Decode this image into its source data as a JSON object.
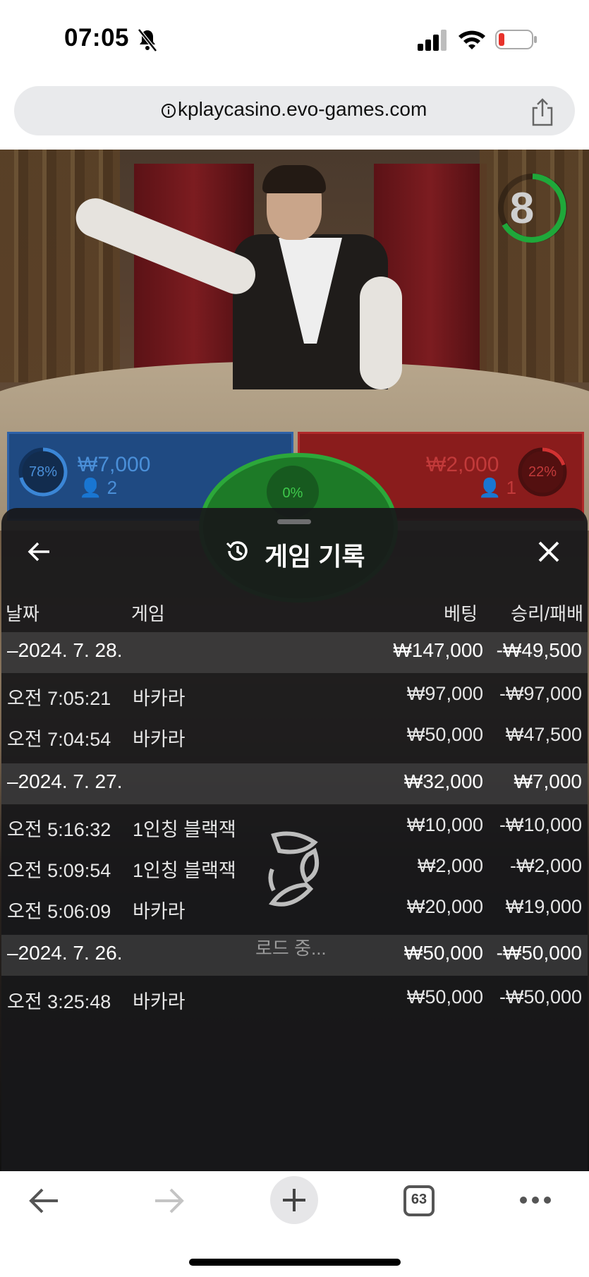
{
  "status": {
    "time": "07:05"
  },
  "browser": {
    "url": "kplaycasino.evo-games.com",
    "tab_count": "63"
  },
  "game": {
    "timer": "8",
    "player": {
      "percent": "78%",
      "amount": "₩7,000",
      "count": "2"
    },
    "banker": {
      "percent": "22%",
      "amount": "₩2,000",
      "count": "1"
    },
    "tie": {
      "percent": "0%"
    }
  },
  "history": {
    "title": "게임 기록",
    "headers": {
      "date": "날짜",
      "game": "게임",
      "bet": "베팅",
      "result": "승리/패배"
    },
    "loading": "로드 중...",
    "groups": [
      {
        "date": "–2024. 7. 28.",
        "bet": "₩147,000",
        "result": "-₩49,500",
        "rows": [
          {
            "time": "오전 7:05:21",
            "game": "바카라",
            "bet": "₩97,000",
            "result": "-₩97,000"
          },
          {
            "time": "오전 7:04:54",
            "game": "바카라",
            "bet": "₩50,000",
            "result": "₩47,500"
          }
        ]
      },
      {
        "date": "–2024. 7. 27.",
        "bet": "₩32,000",
        "result": "₩7,000",
        "rows": [
          {
            "time": "오전 5:16:32",
            "game": "1인칭 블랙잭",
            "bet": "₩10,000",
            "result": "-₩10,000"
          },
          {
            "time": "오전 5:09:54",
            "game": "1인칭 블랙잭",
            "bet": "₩2,000",
            "result": "-₩2,000"
          },
          {
            "time": "오전 5:06:09",
            "game": "바카라",
            "bet": "₩20,000",
            "result": "₩19,000"
          }
        ]
      },
      {
        "date": "–2024. 7. 26.",
        "bet": "₩50,000",
        "result": "-₩50,000",
        "rows": [
          {
            "time": "오전 3:25:48",
            "game": "바카라",
            "bet": "₩50,000",
            "result": "-₩50,000"
          }
        ]
      }
    ]
  }
}
